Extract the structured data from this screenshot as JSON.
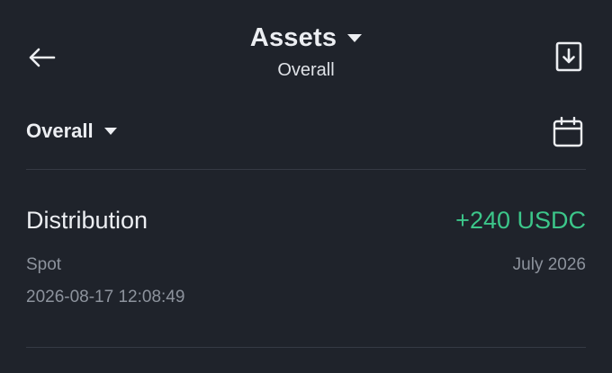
{
  "header": {
    "title": "Assets",
    "subtitle": "Overall",
    "back_icon": "arrow-left-icon",
    "download_icon": "download-icon"
  },
  "filter": {
    "label": "Overall",
    "calendar_icon": "calendar-icon"
  },
  "record": {
    "title": "Distribution",
    "amount": "+240 USDC",
    "type": "Spot",
    "period": "July 2026",
    "timestamp": "2026-08-17 12:08:49"
  },
  "colors": {
    "background": "#1f232b",
    "text_primary": "#eceef2",
    "text_secondary": "#8d939d",
    "positive": "#3cc68a",
    "divider": "#353a44"
  }
}
